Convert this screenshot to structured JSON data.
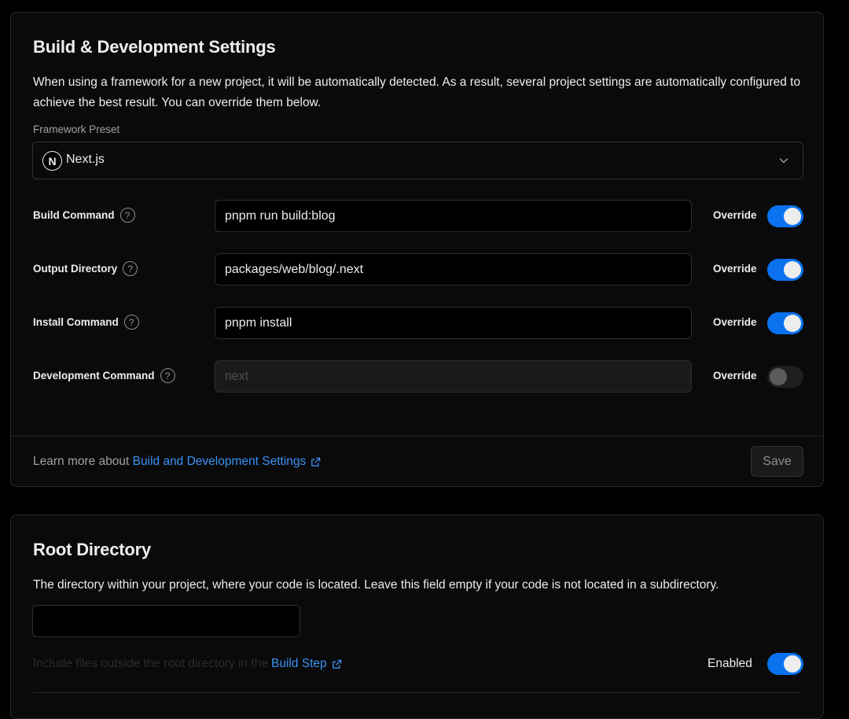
{
  "build_settings": {
    "title": "Build & Development Settings",
    "description": "When using a framework for a new project, it will be automatically detected. As a result, several project settings are automatically configured to achieve the best result. You can override them below.",
    "framework_preset": {
      "label": "Framework Preset",
      "value": "Next.js",
      "logo_letter": "N",
      "icon": "chevron-down-icon"
    },
    "rows": [
      {
        "label": "Build Command",
        "value": "pnpm run build:blog",
        "placeholder": "",
        "override_label": "Override",
        "override": true
      },
      {
        "label": "Output Directory",
        "value": "packages/web/blog/.next",
        "placeholder": "",
        "override_label": "Override",
        "override": true
      },
      {
        "label": "Install Command",
        "value": "pnpm install",
        "placeholder": "",
        "override_label": "Override",
        "override": true
      },
      {
        "label": "Development Command",
        "value": "",
        "placeholder": "next",
        "override_label": "Override",
        "override": false
      }
    ],
    "footer": {
      "prefix": "Learn more about",
      "link_text": "Build and Development Settings",
      "save_label": "Save"
    }
  },
  "root_directory": {
    "title": "Root Directory",
    "description": "The directory within your project, where your code is located. Leave this field empty if your code is not located in a subdirectory.",
    "input_value": "",
    "include_text": "Include files outside the root directory in the",
    "include_link": "Build Step",
    "enabled_label": "Enabled",
    "enabled": true
  },
  "colors": {
    "accent": "#0a72ef",
    "link": "#3b92f6",
    "background": "#000000",
    "card": "#0a0a0a"
  }
}
